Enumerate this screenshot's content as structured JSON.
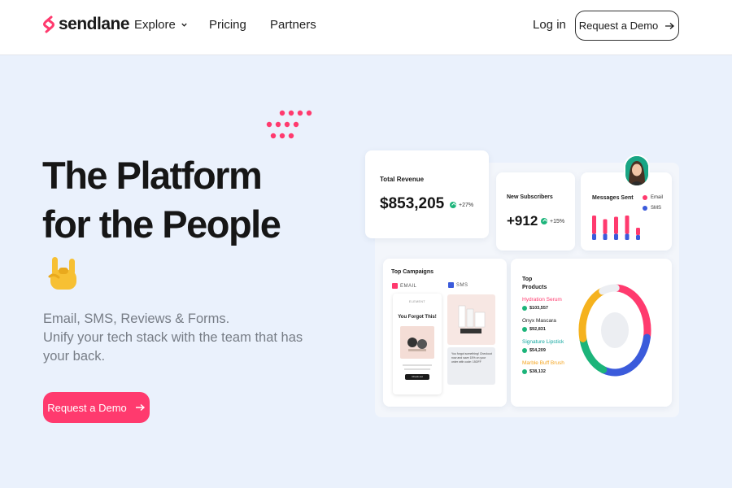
{
  "header": {
    "logo_text": "sendlane",
    "nav": [
      {
        "label": "Explore"
      },
      {
        "label": "Pricing"
      },
      {
        "label": "Partners"
      }
    ],
    "login_label": "Log in",
    "demo_label": "Request a Demo"
  },
  "hero": {
    "title_line1": "The Platform",
    "title_line2": "for the People",
    "subtitle_line1": "Email, SMS, Reviews & Forms.",
    "subtitle_line2": "Unify your tech stack with the team that has your back.",
    "cta_label": "Request a Demo"
  },
  "dashboard": {
    "revenue": {
      "label": "Total Revenue",
      "value": "$853,205",
      "delta": "+27%"
    },
    "subscribers": {
      "label": "New Subscribers",
      "value": "+912",
      "delta": "+15%"
    },
    "messages": {
      "label": "Messages Sent",
      "legend": [
        {
          "name": "Email",
          "color": "#ff3a6e"
        },
        {
          "name": "SMS",
          "color": "#3b5bdb"
        }
      ],
      "bars": [
        {
          "email": 0.75,
          "sms": 0.25
        },
        {
          "email": 0.6,
          "sms": 0.25
        },
        {
          "email": 0.7,
          "sms": 0.25
        },
        {
          "email": 0.75,
          "sms": 0.25
        },
        {
          "email": 0.3,
          "sms": 0.2
        }
      ]
    },
    "campaigns": {
      "label": "Top Campaigns",
      "email_label": "EMAIL",
      "sms_label": "SMS",
      "email_brand": "ELEMENT",
      "email_headline": "You Forgot This!",
      "email_button": "Check out",
      "sms_text": "You forgot something! Checkout now and save 15% on your order with code: 15OFF"
    },
    "products": {
      "label_line1": "Top",
      "label_line2": "Products",
      "items": [
        {
          "name": "Hydration Serum",
          "value": "$103,557",
          "color": "#ff3a6e"
        },
        {
          "name": "Onyx Mascara",
          "value": "$92,831",
          "color": "#1a1a1a"
        },
        {
          "name": "Signature Lipstick",
          "value": "$54,209",
          "color": "#12a7a0"
        },
        {
          "name": "Marble Buff Brush",
          "value": "$38,132",
          "color": "#f5a623"
        }
      ],
      "donut": [
        {
          "color": "#ff3a6e",
          "share": 0.27
        },
        {
          "color": "#3b5bdb",
          "share": 0.28
        },
        {
          "color": "#1cb47a",
          "share": 0.16
        },
        {
          "color": "#f5b21e",
          "share": 0.22
        },
        {
          "color": "#eceef2",
          "share": 0.07
        }
      ]
    }
  },
  "icons": {
    "logo": "sendlane-s-icon",
    "explore_chevron": "chevron-down-icon",
    "arrow": "arrow-right-icon",
    "rock_hand": "rock-on-hand-icon"
  },
  "colors": {
    "accent": "#ff3a6e",
    "page_bg": "#eaf1fc",
    "positive": "#1cb47a"
  }
}
